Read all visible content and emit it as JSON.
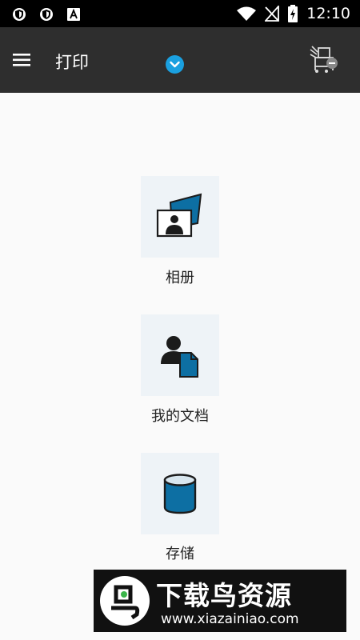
{
  "status_bar": {
    "icons_left": [
      "shield-badge-icon",
      "shield-badge-icon",
      "a-notification-icon"
    ],
    "icons_right": [
      "wifi-icon",
      "no-signal-icon",
      "battery-charging-icon"
    ],
    "time": "12:10"
  },
  "app_bar": {
    "title": "打印",
    "menu_icon": "hamburger-menu-icon",
    "dropdown_icon": "chevron-down-icon",
    "printer_icon": "printer-status-icon",
    "colors": {
      "background": "#2e2e2e",
      "accent": "#1aa0e0"
    }
  },
  "options": [
    {
      "label": "相册",
      "icon": "photo-album-icon"
    },
    {
      "label": "我的文档",
      "icon": "my-documents-icon"
    },
    {
      "label": "存储",
      "icon": "storage-icon"
    }
  ],
  "watermark": {
    "title": "下载鸟资源",
    "url": "www.xiazainiao.com"
  }
}
